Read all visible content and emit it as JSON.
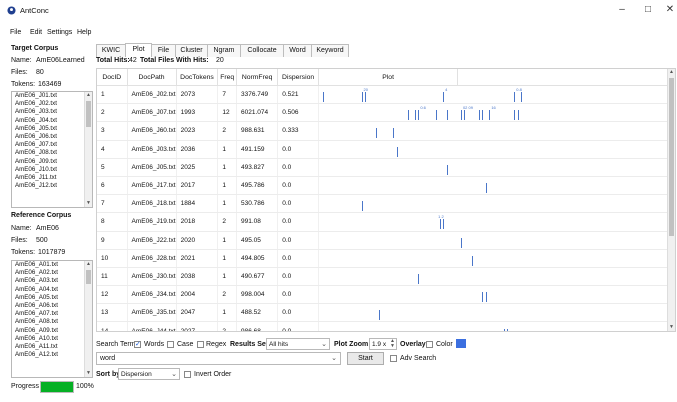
{
  "app": {
    "title": "AntConc"
  },
  "window_controls": {
    "minimize": "–",
    "maximize": "□",
    "close": "✕"
  },
  "menu": [
    "File",
    "Edit",
    "Settings",
    "Help"
  ],
  "target_corpus": {
    "heading": "Target Corpus",
    "name_label": "Name:",
    "name_value": "AmE06Learned",
    "files_label": "Files:",
    "files_value": "80",
    "tokens_label": "Tokens:",
    "tokens_value": "163469",
    "files": [
      "AmE06_J01.txt",
      "AmE06_J02.txt",
      "AmE06_J03.txt",
      "AmE06_J04.txt",
      "AmE06_J05.txt",
      "AmE06_J06.txt",
      "AmE06_J07.txt",
      "AmE06_J08.txt",
      "AmE06_J09.txt",
      "AmE06_J10.txt",
      "AmE06_J11.txt",
      "AmE06_J12.txt"
    ]
  },
  "reference_corpus": {
    "heading": "Reference Corpus",
    "name_label": "Name:",
    "name_value": "AmE06",
    "files_label": "Files:",
    "files_value": "500",
    "tokens_label": "Tokens:",
    "tokens_value": "1017879",
    "files": [
      "AmE06_A01.txt",
      "AmE06_A02.txt",
      "AmE06_A03.txt",
      "AmE06_A04.txt",
      "AmE06_A05.txt",
      "AmE06_A06.txt",
      "AmE06_A07.txt",
      "AmE06_A08.txt",
      "AmE06_A09.txt",
      "AmE06_A10.txt",
      "AmE06_A11.txt",
      "AmE06_A12.txt"
    ]
  },
  "progress": {
    "label": "Progress",
    "value_text": "100%",
    "fraction": 1.0
  },
  "tabs": [
    "KWIC",
    "Plot",
    "File",
    "Cluster",
    "Ngram",
    "Collocate",
    "Word",
    "Keyword"
  ],
  "active_tab": "Plot",
  "hits": {
    "total_label": "Total Hits:",
    "total_value": "42",
    "files_label": "Total Files With Hits:",
    "files_value": "20"
  },
  "table": {
    "columns": [
      "DocID",
      "DocPath",
      "DocTokens",
      "Freq",
      "NormFreq",
      "Dispersion",
      "Plot"
    ],
    "rows": [
      {
        "id": "1",
        "path": "AmE06_J02.txt",
        "tokens": "2073",
        "freq": "7",
        "norm": "3376.749",
        "disp": "0.521",
        "marks": [
          0.01,
          0.12,
          0.13,
          0.35,
          0.55,
          0.57
        ],
        "labels": [
          [
            0.12,
            "20"
          ],
          [
            0.35,
            "4"
          ],
          [
            0.55,
            "0.8"
          ]
        ]
      },
      {
        "id": "2",
        "path": "AmE06_J07.txt",
        "tokens": "1993",
        "freq": "12",
        "norm": "6021.074",
        "disp": "0.506",
        "marks": [
          0.25,
          0.27,
          0.28,
          0.33,
          0.36,
          0.4,
          0.41,
          0.45,
          0.46,
          0.48,
          0.55,
          0.56
        ],
        "labels": [
          [
            0.28,
            "0.6"
          ],
          [
            0.4,
            "02 09"
          ],
          [
            0.48,
            "16"
          ]
        ]
      },
      {
        "id": "3",
        "path": "AmE06_J60.txt",
        "tokens": "2023",
        "freq": "2",
        "norm": "988.631",
        "disp": "0.333",
        "marks": [
          0.16,
          0.21
        ],
        "labels": []
      },
      {
        "id": "4",
        "path": "AmE06_J03.txt",
        "tokens": "2036",
        "freq": "1",
        "norm": "491.159",
        "disp": "0.0",
        "marks": [
          0.22
        ],
        "labels": []
      },
      {
        "id": "5",
        "path": "AmE06_J05.txt",
        "tokens": "2025",
        "freq": "1",
        "norm": "493.827",
        "disp": "0.0",
        "marks": [
          0.36
        ],
        "labels": []
      },
      {
        "id": "6",
        "path": "AmE06_J17.txt",
        "tokens": "2017",
        "freq": "1",
        "norm": "495.786",
        "disp": "0.0",
        "marks": [
          0.47
        ],
        "labels": []
      },
      {
        "id": "7",
        "path": "AmE06_J18.txt",
        "tokens": "1884",
        "freq": "1",
        "norm": "530.786",
        "disp": "0.0",
        "marks": [
          0.12
        ],
        "labels": []
      },
      {
        "id": "8",
        "path": "AmE06_J19.txt",
        "tokens": "2018",
        "freq": "2",
        "norm": "991.08",
        "disp": "0.0",
        "marks": [
          0.34,
          0.35
        ],
        "labels": [
          [
            0.33,
            "1 2"
          ]
        ]
      },
      {
        "id": "9",
        "path": "AmE06_J22.txt",
        "tokens": "2020",
        "freq": "1",
        "norm": "495.05",
        "disp": "0.0",
        "marks": [
          0.4
        ],
        "labels": []
      },
      {
        "id": "10",
        "path": "AmE06_J28.txt",
        "tokens": "2021",
        "freq": "1",
        "norm": "494.805",
        "disp": "0.0",
        "marks": [
          0.43
        ],
        "labels": []
      },
      {
        "id": "11",
        "path": "AmE06_J30.txt",
        "tokens": "2038",
        "freq": "1",
        "norm": "490.677",
        "disp": "0.0",
        "marks": [
          0.28
        ],
        "labels": []
      },
      {
        "id": "12",
        "path": "AmE06_J34.txt",
        "tokens": "2004",
        "freq": "2",
        "norm": "998.004",
        "disp": "0.0",
        "marks": [
          0.46,
          0.47
        ],
        "labels": []
      },
      {
        "id": "13",
        "path": "AmE06_J35.txt",
        "tokens": "2047",
        "freq": "1",
        "norm": "488.52",
        "disp": "0.0",
        "marks": [
          0.17
        ],
        "labels": []
      },
      {
        "id": "14",
        "path": "AmE06_J44.txt",
        "tokens": "2027",
        "freq": "2",
        "norm": "986.68",
        "disp": "0.0",
        "marks": [
          0.52,
          0.53
        ],
        "labels": []
      }
    ]
  },
  "controls": {
    "search_term_label": "Search Term",
    "words_label": "Words",
    "words_checked": true,
    "case_label": "Case",
    "case_checked": false,
    "regex_label": "Regex",
    "regex_checked": false,
    "results_set_label": "Results Set",
    "results_set_value": "All hits",
    "plot_zoom_label": "Plot Zoom",
    "plot_zoom_value": "1.9 x",
    "overlay_label": "Overlay",
    "color_label": "Color",
    "color_swatch": "#3b6fe0",
    "search_value": "word",
    "start_label": "Start",
    "adv_search_label": "Adv Search",
    "sort_by_label": "Sort by",
    "sort_by_value": "Dispersion",
    "invert_order_label": "Invert Order"
  }
}
